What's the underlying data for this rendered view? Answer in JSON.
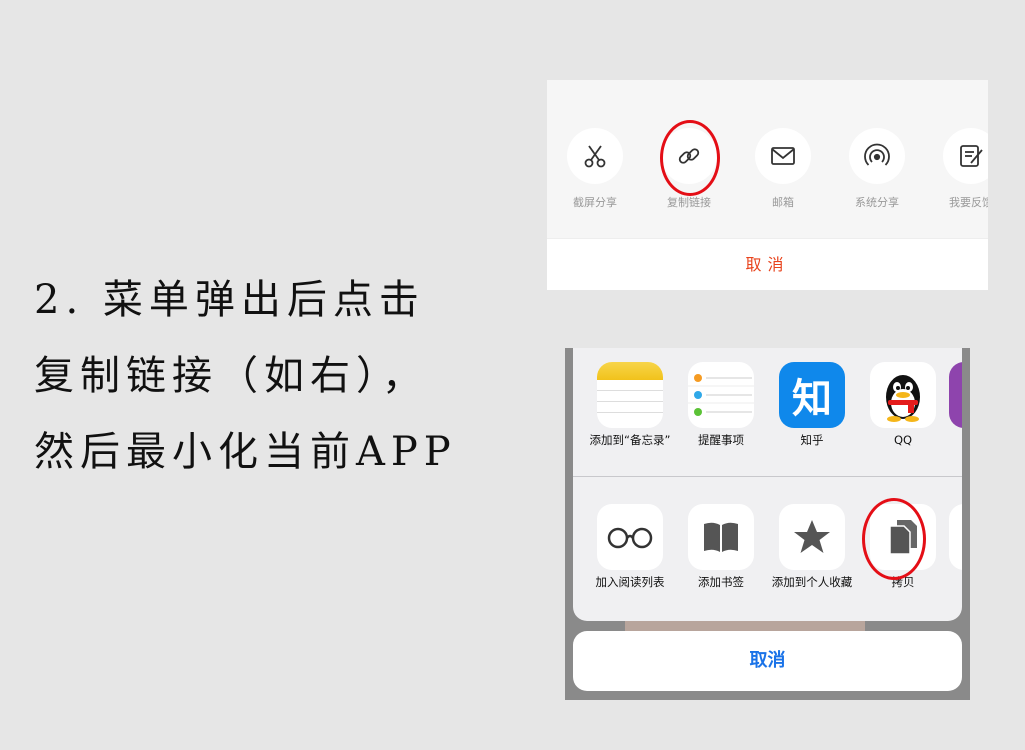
{
  "instruction": {
    "line1": "2. 菜单弹出后点击",
    "line2": "复制链接（如右），",
    "line3": "然后最小化当前APP"
  },
  "panel1": {
    "items": [
      {
        "label": "截屏分享",
        "icon": "scissors-icon"
      },
      {
        "label": "复制链接",
        "icon": "link-icon"
      },
      {
        "label": "邮箱",
        "icon": "mail-icon"
      },
      {
        "label": "系统分享",
        "icon": "broadcast-icon"
      },
      {
        "label": "我要反馈",
        "icon": "feedback-icon"
      }
    ],
    "cancel": "取消",
    "colors": {
      "cancel": "#e8431c",
      "highlight": "#e40e16"
    }
  },
  "panel2": {
    "apps": [
      {
        "label": "添加到“备忘录”",
        "icon": "notes-icon"
      },
      {
        "label": "提醒事项",
        "icon": "reminders-icon"
      },
      {
        "label": "知乎",
        "icon": "zhihu-icon",
        "glyph": "知"
      },
      {
        "label": "QQ",
        "icon": "qq-icon"
      }
    ],
    "actions": [
      {
        "label": "加入阅读列表",
        "icon": "reading-list-icon"
      },
      {
        "label": "添加书签",
        "icon": "bookmark-icon"
      },
      {
        "label": "添加到个人收藏",
        "icon": "favorite-star-icon"
      },
      {
        "label": "拷贝",
        "icon": "copy-icon"
      }
    ],
    "cancel": "取消",
    "colors": {
      "cancel": "#1a73e8",
      "zhihu": "#0f88eb"
    }
  }
}
